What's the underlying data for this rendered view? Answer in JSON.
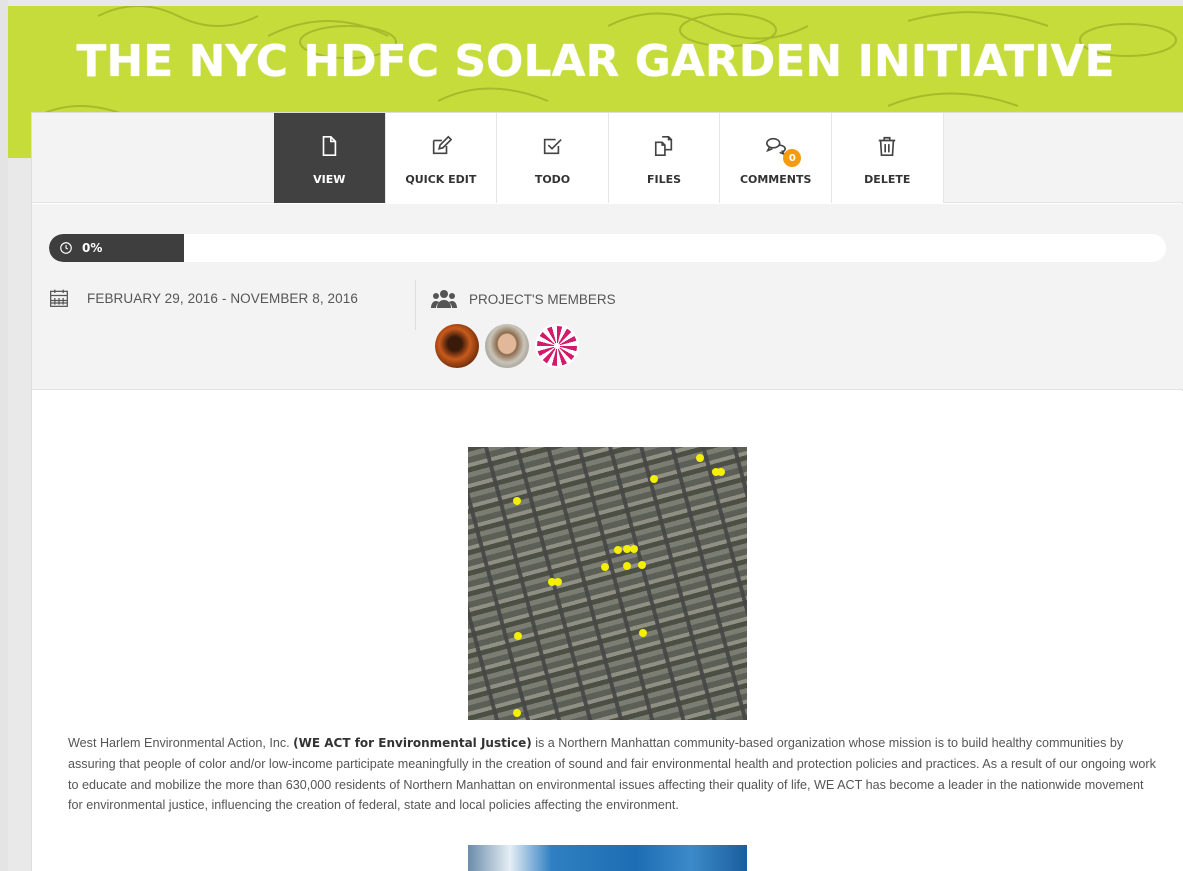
{
  "banner": {
    "title": "THE NYC HDFC SOLAR GARDEN INITIATIVE",
    "color": "#c5dc3a"
  },
  "toolbar": {
    "tabs": [
      {
        "label": "VIEW",
        "icon": "file-icon",
        "active": true
      },
      {
        "label": "QUICK EDIT",
        "icon": "edit-icon",
        "active": false
      },
      {
        "label": "TODO",
        "icon": "checkbox-icon",
        "active": false
      },
      {
        "label": "FILES",
        "icon": "files-icon",
        "active": false
      },
      {
        "label": "COMMENTS",
        "icon": "comments-icon",
        "active": false,
        "badge": "0"
      },
      {
        "label": "DELETE",
        "icon": "trash-icon",
        "active": false
      }
    ]
  },
  "progress": {
    "label": "0%",
    "value": 0
  },
  "project": {
    "dates": "FEBRUARY 29, 2016 - NOVEMBER 8, 2016",
    "members_label": "PROJECT'S MEMBERS",
    "members": [
      "member-1",
      "member-2",
      "member-3"
    ]
  },
  "content": {
    "paragraph_pre": "West Harlem Environmental Action, Inc. ",
    "paragraph_bold": "(WE ACT for Environmental Justice)",
    "paragraph_post": " is a Northern Manhattan community-based organization whose mission is to build healthy communities by assuring that people of color and/or low-income participate meaningfully in the creation of sound and fair environmental health and protection policies and practices. As a result of our ongoing work to educate and mobilize the more than 630,000 residents of Northern Manhattan on environmental issues affecting their quality of life, WE ACT has become a leader in the nationwide movement for environmental justice, influencing the creation of federal, state and local policies affecting the environment."
  },
  "colors": {
    "active_tab": "#414141",
    "badge": "#f39c12",
    "map_dot": "#f4f000"
  }
}
